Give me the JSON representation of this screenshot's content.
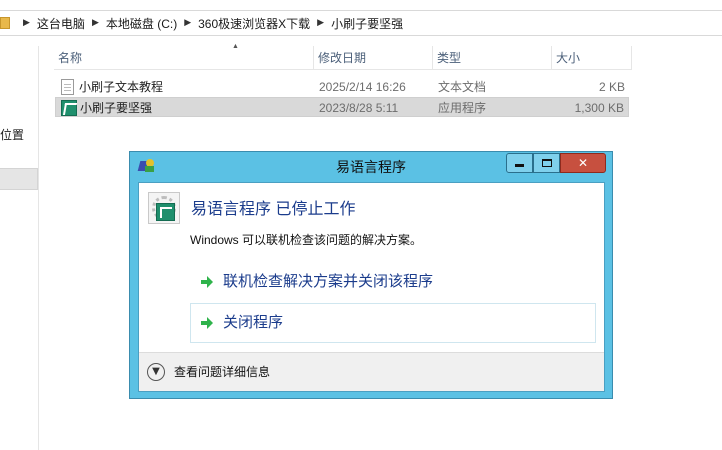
{
  "explorer": {
    "breadcrumb": [
      "这台电脑",
      "本地磁盘 (C:)",
      "360极速浏览器X下载",
      "小刷子要坚强"
    ],
    "nav_partial_label": "位置",
    "columns": {
      "name": "名称",
      "modified": "修改日期",
      "type": "类型",
      "size": "大小"
    },
    "files": [
      {
        "name": "小刷子文本教程",
        "modified": "2025/2/14 16:26",
        "type": "文本文档",
        "size": "2 KB",
        "icon": "text-file-icon"
      },
      {
        "name": "小刷子要坚强",
        "modified": "2023/8/28 5:11",
        "type": "应用程序",
        "size": "1,300 KB",
        "icon": "app-icon"
      }
    ]
  },
  "dialog": {
    "title": "易语言程序",
    "heading": "易语言程序 已停止工作",
    "description": "Windows 可以联机检查该问题的解决方案。",
    "commands": [
      "联机检查解决方案并关闭该程序",
      "关闭程序"
    ],
    "details_label": "查看问题详细信息",
    "controls": {
      "minimize": "minimize-icon",
      "maximize": "maximize-icon",
      "close": "✕"
    }
  }
}
